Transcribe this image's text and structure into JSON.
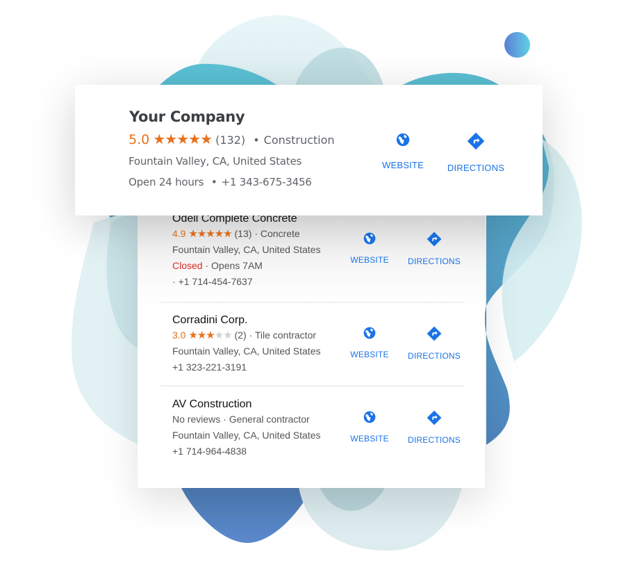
{
  "colors": {
    "accent_blue": "#1a73e8",
    "rating_orange": "#e7711b",
    "closed_red": "#d93025",
    "teal_blob": "#55bccf",
    "blue_blob": "#4f7fc2"
  },
  "featured": {
    "name": "Your Company",
    "rating": "5.0",
    "stars_filled": 5,
    "reviews": "(132)",
    "category": "Construction",
    "address": "Fountain Valley, CA, United States",
    "hours": "Open 24 hours",
    "phone": "+1 343-675-3456",
    "website_label": "WEBSITE",
    "directions_label": "DIRECTIONS",
    "separator": "•"
  },
  "listings": [
    {
      "name": "Odell Complete Concrete",
      "rating": "4.9",
      "stars_filled": 5,
      "reviews": "(13)",
      "category": "Concrete",
      "address": "Fountain Valley, CA, United States",
      "status": "Closed",
      "status_detail": "Opens 7AM",
      "phone": "+1 714-454-7637",
      "website_label": "WEBSITE",
      "directions_label": "DIRECTIONS"
    },
    {
      "name": "Corradini Corp.",
      "rating": "3.0",
      "stars_filled": 3,
      "reviews": "(2)",
      "category": "Tile contractor",
      "address": "Fountain Valley, CA, United States",
      "phone": "+1 323-221-3191",
      "website_label": "WEBSITE",
      "directions_label": "DIRECTIONS"
    },
    {
      "name": "AV Construction",
      "reviews_text": "No reviews",
      "category": "General contractor",
      "address": "Fountain Valley, CA, United States",
      "phone": "+1 714-964-4838",
      "website_label": "WEBSITE",
      "directions_label": "DIRECTIONS"
    }
  ],
  "mid_dot": "·",
  "star_glyph": "★"
}
